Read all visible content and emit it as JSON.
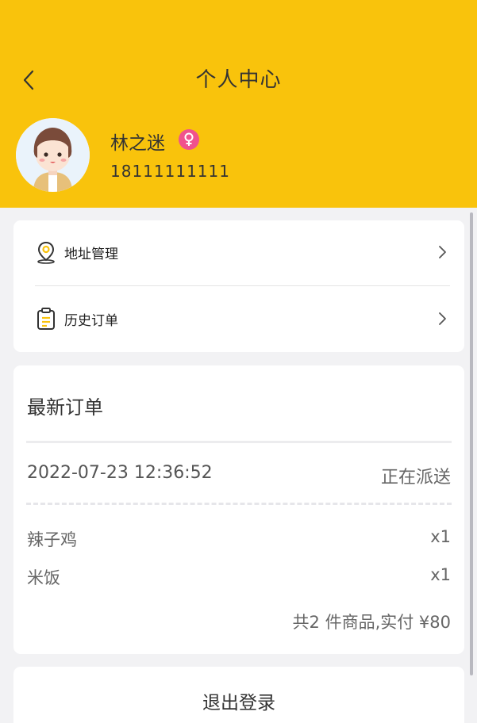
{
  "header": {
    "title": "个人中心",
    "back_icon": "chevron-left-icon",
    "bg_color": "#f9c30c"
  },
  "profile": {
    "name": "林之迷",
    "gender_icon": "female-icon",
    "gender_color": "#f0528d",
    "phone": "18111111111"
  },
  "menu": {
    "items": [
      {
        "label": "地址管理",
        "icon": "location-pin-icon"
      },
      {
        "label": "历史订单",
        "icon": "clipboard-icon"
      }
    ]
  },
  "latest_order": {
    "title": "最新订单",
    "time": "2022-07-23 12:36:52",
    "status": "正在派送",
    "items": [
      {
        "name": "辣子鸡",
        "qty": "x1"
      },
      {
        "name": "米饭",
        "qty": "x1"
      }
    ],
    "summary": "共2 件商品,实付 ¥80"
  },
  "logout": {
    "label": "退出登录"
  }
}
